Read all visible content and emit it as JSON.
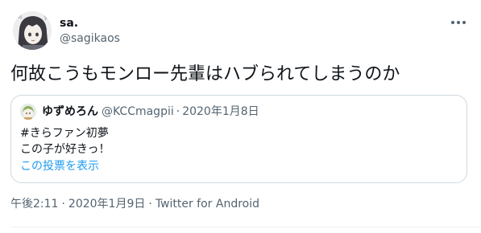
{
  "author": {
    "name": "sa.",
    "handle": "@sagikaos"
  },
  "more_icon": "more-horizontal-icon",
  "tweet": {
    "text": "何故こうもモンロー先輩はハブられてしまうのか"
  },
  "quote": {
    "name": "ゆずめろん",
    "handle": "@KCCmagpii",
    "separator": "·",
    "date": "2020年1月8日",
    "line1": "#きらファン初夢",
    "line2": "この子が好きっ！",
    "link": "この投票を表示"
  },
  "meta": {
    "time": "午後2:11",
    "separator": "·",
    "date": "2020年1月9日",
    "separator2": "·",
    "source": "Twitter for Android"
  },
  "colors": {
    "text": "#0f1419",
    "secondary": "#536471",
    "link": "#1d9bf0",
    "border": "#cfd9de"
  }
}
